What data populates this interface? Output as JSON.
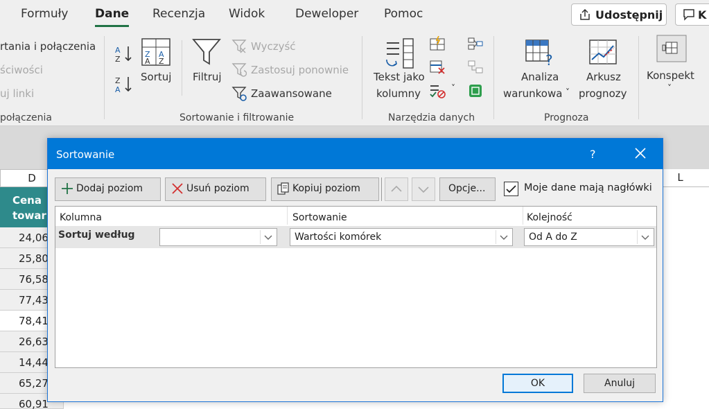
{
  "ribbon_tabs": [
    "Formuły",
    "Dane",
    "Recenzja",
    "Widok",
    "Deweloper",
    "Pomoc"
  ],
  "share_label": "Udostępnij",
  "comments_label": "K",
  "queries": {
    "item1": "rtania i połączenia",
    "item2": "ściwości",
    "item3": "uj linki",
    "group_label": "połączenia"
  },
  "sort_filter": {
    "sort_label": "Sortuj",
    "filter_label": "Filtruj",
    "clear_label": "Wyczyść",
    "reapply_label": "Zastosuj ponownie",
    "advanced_label": "Zaawansowane",
    "group_label": "Sortowanie i filtrowanie"
  },
  "data_tools": {
    "text_to_columns_line1": "Tekst jako",
    "text_to_columns_line2": "kolumny",
    "group_label": "Narzędzia danych"
  },
  "forecast": {
    "whatif_line1": "Analiza",
    "whatif_line2": "warunkowa",
    "forecast_line1": "Arkusz",
    "forecast_line2": "prognozy",
    "group_label": "Prognoza"
  },
  "outline": {
    "label": "Konspekt"
  },
  "sheet": {
    "col_d": "D",
    "col_l": "L",
    "header_line1": "Cena",
    "header_line2": "towaru",
    "values": [
      "24,06",
      "25,80",
      "76,58",
      "77,43",
      "78,41",
      "26,63",
      "14,44",
      "65,27",
      "60,91"
    ]
  },
  "dialog": {
    "title": "Sortowanie",
    "help": "?",
    "add_level": "Dodaj poziom",
    "delete_level": "Usuń poziom",
    "copy_level": "Kopiuj poziom",
    "options": "Opcje...",
    "headers_checkbox_label": "Moje dane mają nagłówki",
    "headers_checked": true,
    "col_header": "Kolumna",
    "sort_header": "Sortowanie",
    "order_header": "Kolejność",
    "row_label": "Sortuj według",
    "column_value": "",
    "sort_on_value": "Wartości komórek",
    "order_value": "Od A do Z",
    "ok": "OK",
    "cancel": "Anuluj"
  },
  "colors": {
    "accent": "#0078d7",
    "excel_green": "#217346",
    "header_teal": "#2e8a8b"
  }
}
